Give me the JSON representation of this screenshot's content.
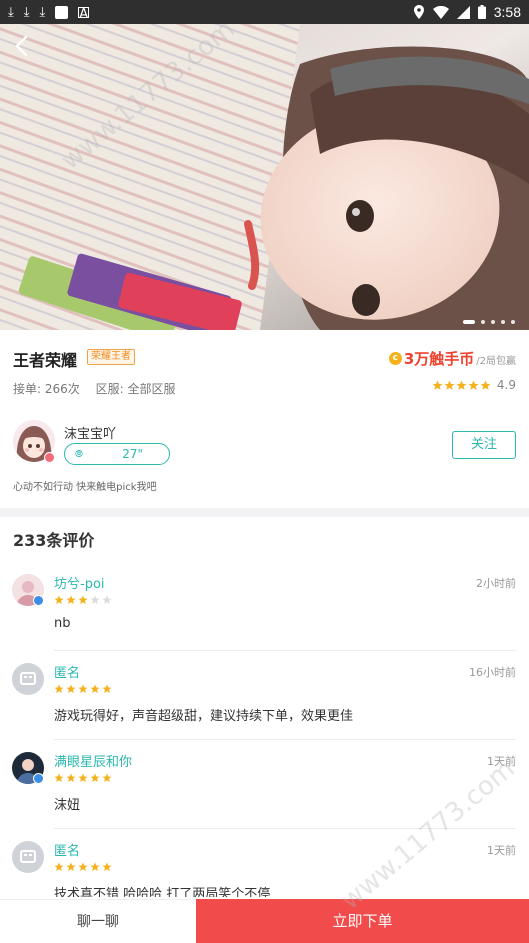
{
  "status_bar": {
    "time": "3:58"
  },
  "hero": {
    "page_count": 5,
    "active_page": 1
  },
  "profile": {
    "game": "王者荣耀",
    "rank_badge": "荣耀王者",
    "price": "3万触手币",
    "price_unit": "/2局包赢",
    "orders": "接单: 266次",
    "server": "区服: 全部区服",
    "rating": "4.9",
    "rating_stars": 5,
    "nickname": "沫宝宝吖",
    "voice_length": "27\"",
    "follow": "关注",
    "signature": "心动不如行动 快来触电pick我吧"
  },
  "reviews": {
    "title": "233条评价",
    "items": [
      {
        "name": "坊兮-poi",
        "time": "2小时前",
        "stars": 3,
        "text": "nb",
        "avatar": "photo"
      },
      {
        "name": "匿名",
        "time": "16小时前",
        "stars": 5,
        "text": "游戏玩得好，声音超级甜，建议持续下单，效果更佳",
        "avatar": "anonymous"
      },
      {
        "name": "满眼星辰和你",
        "time": "1天前",
        "stars": 5,
        "text": "沫妞",
        "avatar": "photo"
      },
      {
        "name": "匿名",
        "time": "1天前",
        "stars": 5,
        "text": "技术真不错 哈哈哈 打了两局笑个不停",
        "avatar": "anonymous"
      }
    ]
  },
  "actions": {
    "chat": "聊一聊",
    "order": "立即下单"
  },
  "colors": {
    "accent": "#2ab8b0",
    "price": "#f0412e",
    "order": "#f24b4b",
    "star": "#f5b21e"
  },
  "watermark": "www.11773.com"
}
